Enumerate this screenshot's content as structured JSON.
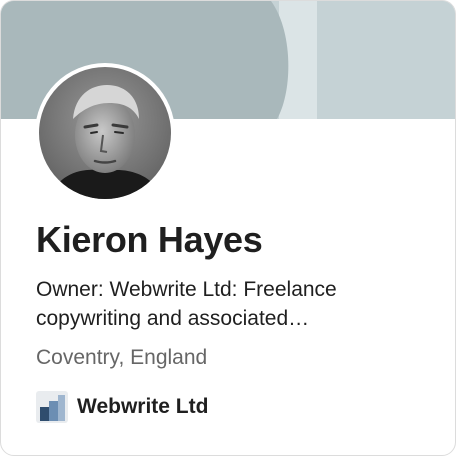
{
  "profile": {
    "name": "Kieron Hayes",
    "headline": "Owner: Webwrite Ltd: Freelance copywriting and associated…",
    "location": "Coventry, England"
  },
  "company": {
    "name": "Webwrite Ltd",
    "logo_icon": "company-logo-bars"
  },
  "colors": {
    "banner_dark": "#a9b8bb",
    "banner_light": "#c5d2d5",
    "banner_stripe": "#dbe4e6",
    "text_primary": "#1f1f1f",
    "text_secondary": "#666666"
  }
}
